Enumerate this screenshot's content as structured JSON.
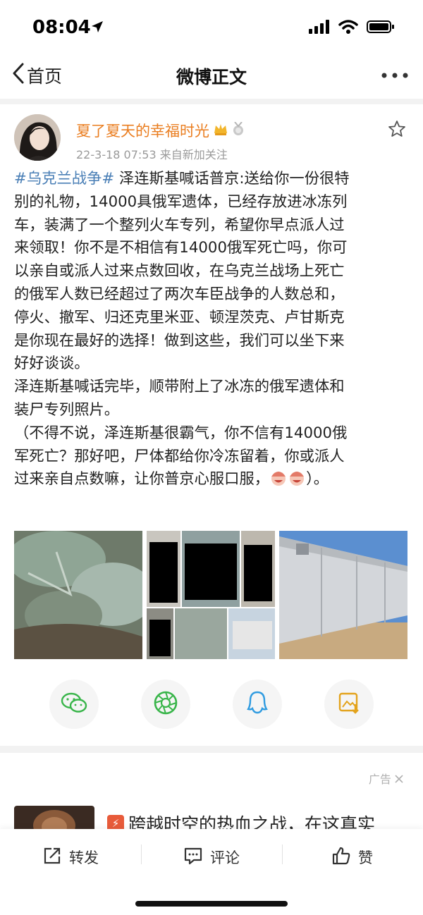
{
  "status": {
    "time": "08:04"
  },
  "nav": {
    "back_label": "首页",
    "title": "微博正文"
  },
  "post": {
    "author": "夏了夏天的幸福时光",
    "meta": "22-3-18 07:53  来自新加关注",
    "topic": "#乌克兰战争#",
    "lines": [
      " 泽连斯基喊话普京:送给你一份很特",
      "别的礼物，14000具俄军遗体，已经存放进冰冻列",
      "车，装满了一个整列火车专列，希望你早点派人过",
      "来领取！你不是不相信有14000俄军死亡吗，你可",
      "以亲自或派人过来点数回收，在乌克兰战场上死亡",
      "的俄军人数已经超过了两次车臣战争的人数总和，",
      "停火、撤军、归还克里米亚、顿涅茨克、卢甘斯克",
      "是你现在最好的选择！做到这些，我们可以坐下来",
      "好好谈谈。",
      "泽连斯基喊话完毕，顺带附上了冰冻的俄军遗体和",
      "装尸专列照片。",
      "（不得不说，泽连斯基很霸气，你不信有14000俄",
      "军死亡？那好吧，尸体都给你冷冻留着，你或派人",
      "过来亲自点数嘛，让你普京心服口服，",
      "）。"
    ]
  },
  "share": {
    "icons": [
      "wechat-icon",
      "moments-icon",
      "qq-icon",
      "save-image-icon"
    ]
  },
  "ad": {
    "label": "广告",
    "title": "跨越时空的热血之战，在这真实"
  },
  "toolbar": {
    "repost": "转发",
    "comment": "评论",
    "like": "赞"
  },
  "colors": {
    "author": "#ea7d1f",
    "topic": "#4a7fb6",
    "meta": "#9a9a9a"
  }
}
